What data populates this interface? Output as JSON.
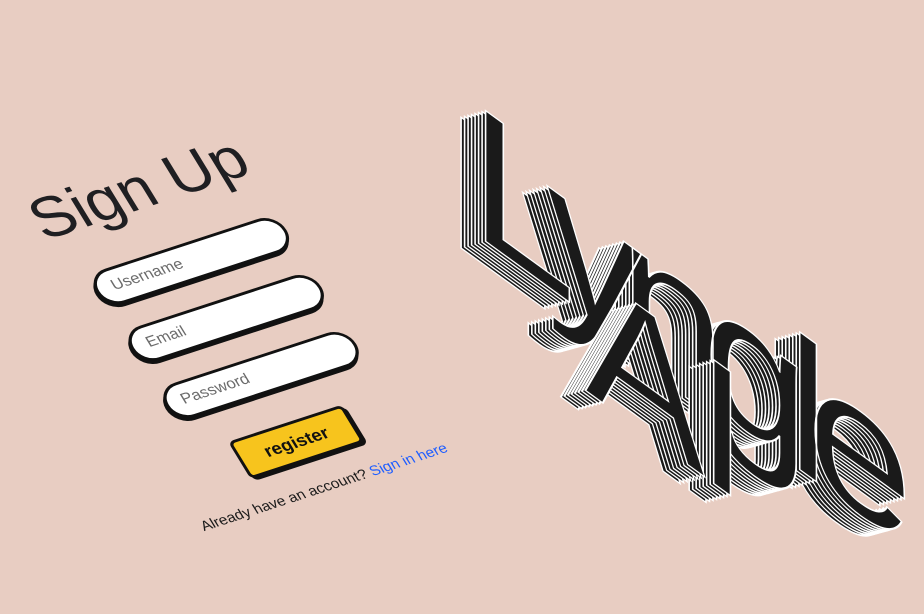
{
  "form": {
    "title": "Sign Up",
    "username_placeholder": "Username",
    "email_placeholder": "Email",
    "password_placeholder": "Password",
    "register_label": "register",
    "signin_prompt": "Already have an account?",
    "signin_link": "Sign in here"
  },
  "logo": {
    "line1": "Lyngle",
    "line2": "AI"
  },
  "colors": {
    "background": "#e8cdc2",
    "button": "#f7c41d",
    "link": "#1f5eff"
  }
}
